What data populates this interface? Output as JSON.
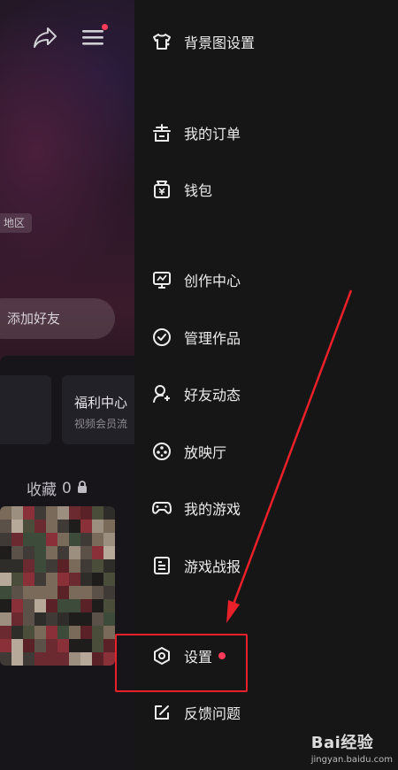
{
  "background": {
    "region_tag": "地区",
    "add_friend": "添加好友",
    "welfare_card": {
      "title": "福利中心",
      "subtitle": "视频会员流"
    },
    "collection": {
      "label": "收藏",
      "count": "0"
    }
  },
  "drawer": {
    "items": [
      {
        "label": "背景图设置",
        "icon": "tshirt-icon"
      },
      {
        "label": "我的订单",
        "icon": "order-icon"
      },
      {
        "label": "钱包",
        "icon": "wallet-icon"
      },
      {
        "label": "创作中心",
        "icon": "creator-icon"
      },
      {
        "label": "管理作品",
        "icon": "check-circle-icon"
      },
      {
        "label": "好友动态",
        "icon": "friend-activity-icon"
      },
      {
        "label": "放映厅",
        "icon": "film-reel-icon"
      },
      {
        "label": "我的游戏",
        "icon": "gamepad-icon"
      },
      {
        "label": "游戏战报",
        "icon": "report-icon"
      },
      {
        "label": "设置",
        "icon": "settings-icon",
        "badge": true
      },
      {
        "label": "反馈问题",
        "icon": "feedback-icon"
      }
    ]
  },
  "watermark": {
    "brand": "Bai经验",
    "url": "jingyan.baidu.com"
  },
  "colors": {
    "accent_red": "#e8202a",
    "badge": "#ff3b5c",
    "drawer_bg": "#161616"
  }
}
